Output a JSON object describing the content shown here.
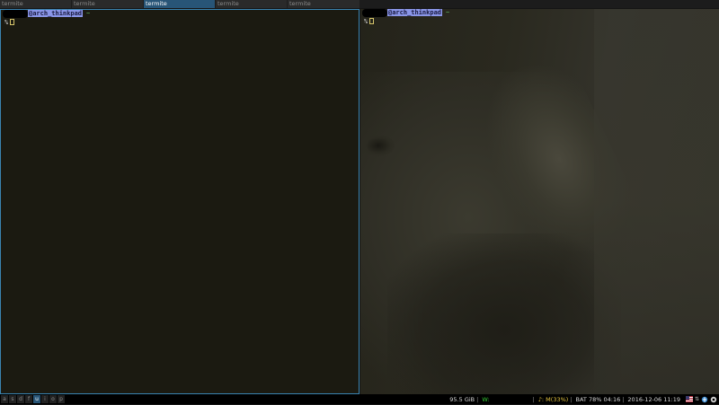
{
  "tabs": [
    {
      "label": "termite",
      "active": false
    },
    {
      "label": "termite",
      "active": false
    },
    {
      "label": "termite",
      "active": true
    },
    {
      "label": "termite",
      "active": false
    },
    {
      "label": "termite",
      "active": false
    }
  ],
  "terminals": {
    "left": {
      "prompt_host": "@arch_thinkpad",
      "prompt_dir": "~",
      "prompt_symbol": "%"
    },
    "right": {
      "prompt_host": "@arch_thinkpad",
      "prompt_dir": "~",
      "prompt_symbol": "%"
    }
  },
  "workspaces": [
    {
      "label": "a",
      "active": false
    },
    {
      "label": "s",
      "active": false
    },
    {
      "label": "d",
      "active": false
    },
    {
      "label": "f",
      "active": false
    },
    {
      "label": "u",
      "active": true
    },
    {
      "label": "i",
      "active": false
    },
    {
      "label": "o",
      "active": false
    },
    {
      "label": "p",
      "active": false
    }
  ],
  "status": {
    "disk": "95.5 GiB",
    "wifi": "W:",
    "music": "♪: M(33%)",
    "battery": "BAT 78% 04:16",
    "datetime": "2016-12-06 11:19"
  },
  "tray_icons": [
    "flag-icon",
    "network-icon",
    "update-icon",
    "settings-icon"
  ],
  "colors": {
    "accent": "#285577",
    "border_focused": "#3a83b0",
    "host_highlight": "#8a96e8",
    "wifi_ok": "#33cc33",
    "music": "#e0c040"
  }
}
